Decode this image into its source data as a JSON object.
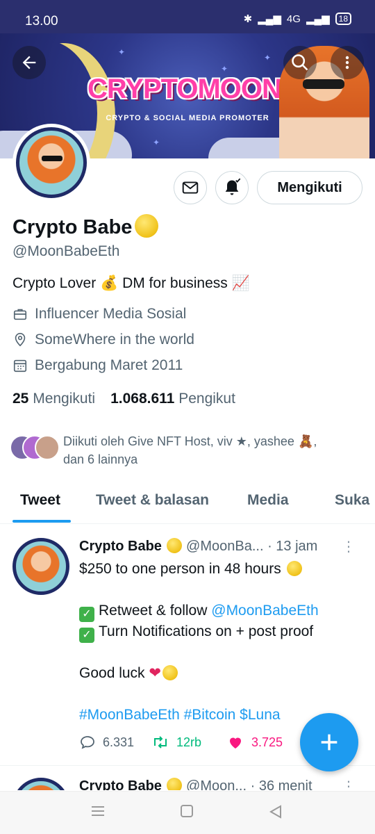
{
  "status_bar": {
    "time": "13.00",
    "network": "4G",
    "battery": "18"
  },
  "banner": {
    "logo_text": "CRYPTOMOONETH",
    "subtitle": "CRYPTO & SOCIAL MEDIA PROMOTER"
  },
  "profile": {
    "display_name": "Crypto Babe",
    "handle": "@MoonBabeEth",
    "bio_text": "Crypto Lover",
    "bio_dm": "DM for business",
    "category": "Influencer Media Sosial",
    "location": "SomeWhere in the world",
    "joined": "Bergabung Maret 2011",
    "following_count": "25",
    "following_label": "Mengikuti",
    "followers_count": "1.068.611",
    "followers_label": "Pengikut",
    "follow_button": "Mengikuti",
    "followed_by_line1": "Diikuti oleh Give NFT Host, viv ★, yashee",
    "followed_by_line2": "dan 6 lainnya"
  },
  "tabs": [
    {
      "label": "Tweet",
      "active": true
    },
    {
      "label": "Tweet & balasan",
      "active": false
    },
    {
      "label": "Media",
      "active": false
    },
    {
      "label": "Suka",
      "active": false
    }
  ],
  "tweets": [
    {
      "name": "Crypto Babe",
      "handle": "@MoonBa...",
      "time": "· 13 jam",
      "line1": "$250 to one person in 48 hours",
      "line2_prefix": "Retweet & follow",
      "line2_link": "@MoonBabeEth",
      "line3": "Turn Notifications on + post proof",
      "line4": "Good luck",
      "hashtags": "#MoonBabeEth #Bitcoin $Luna",
      "replies": "6.331",
      "retweets": "12rb",
      "likes": "3.725"
    },
    {
      "name": "Crypto Babe",
      "handle": "@Moon...",
      "time": "· 36 menit"
    }
  ],
  "colors": {
    "accent": "#1d9bf0",
    "text_primary": "#0f1419",
    "text_secondary": "#536471",
    "retweet": "#00ba7c",
    "like": "#f91880",
    "banner_bg": "#2c3688",
    "logo_pink": "#ff3fa8"
  },
  "icons": {
    "back": "arrow-left-icon",
    "search": "search-icon",
    "more": "more-vertical-icon",
    "mail": "mail-icon",
    "bell": "bell-icon",
    "briefcase": "briefcase-icon",
    "location": "location-pin-icon",
    "calendar": "calendar-icon",
    "reply": "reply-icon",
    "retweet": "retweet-icon",
    "like": "heart-icon",
    "compose": "plus-icon"
  }
}
